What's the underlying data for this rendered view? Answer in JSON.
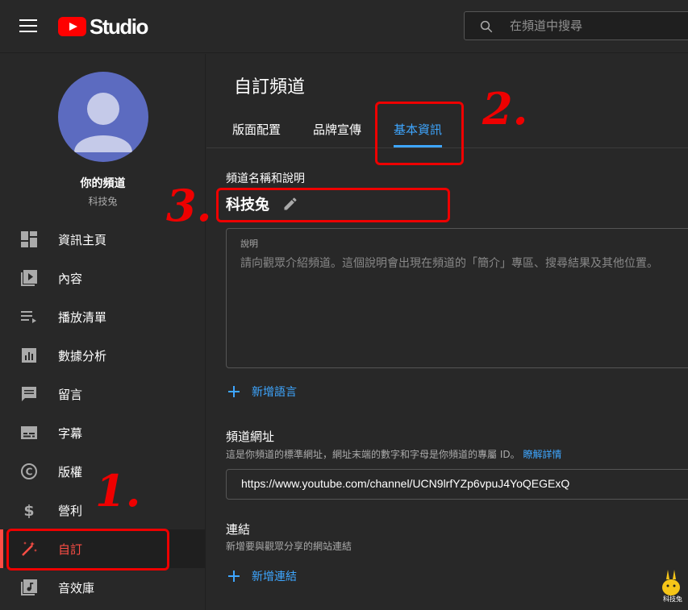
{
  "header": {
    "logo_text": "Studio",
    "search_placeholder": "在頻道中搜尋"
  },
  "sidebar": {
    "channel_title": "你的頻道",
    "channel_name": "科技兔",
    "items": [
      {
        "label": "資訊主頁",
        "icon": "dashboard-icon"
      },
      {
        "label": "內容",
        "icon": "content-icon"
      },
      {
        "label": "播放清單",
        "icon": "playlist-icon"
      },
      {
        "label": "數據分析",
        "icon": "analytics-icon"
      },
      {
        "label": "留言",
        "icon": "comments-icon"
      },
      {
        "label": "字幕",
        "icon": "subtitles-icon"
      },
      {
        "label": "版權",
        "icon": "copyright-icon"
      },
      {
        "label": "營利",
        "icon": "dollar-icon"
      },
      {
        "label": "自訂",
        "icon": "magic-wand-icon",
        "active": true
      },
      {
        "label": "音效庫",
        "icon": "audio-library-icon"
      }
    ]
  },
  "main": {
    "title": "自訂頻道",
    "tabs": [
      {
        "label": "版面配置"
      },
      {
        "label": "品牌宣傳"
      },
      {
        "label": "基本資訊",
        "active": true
      }
    ],
    "name_section": {
      "label": "頻道名稱和說明",
      "channel_name": "科技兔",
      "description_label": "說明",
      "description_placeholder": "請向觀眾介紹頻道。這個說明會出現在頻道的「簡介」專區、搜尋結果及其他位置。"
    },
    "add_language": "新增語言",
    "url_section": {
      "label": "頻道網址",
      "help": "這是你頻道的標準網址，網址末端的數字和字母是你頻道的專屬 ID。",
      "help_link": "瞭解詳情",
      "url": "https://www.youtube.com/channel/UCN9lrfYZp6vpuJ4YoQEGExQ"
    },
    "links_section": {
      "label": "連結",
      "help": "新增要與觀眾分享的網站連結",
      "add_link": "新增連結"
    }
  },
  "annotations": {
    "step1": "1.",
    "step2": "2.",
    "step3": "3."
  },
  "watermark": "科技兔",
  "colors": {
    "background": "#282828",
    "accent_blue": "#3ea6ff",
    "active_red": "#ff4e45",
    "annotation_red": "#e00000",
    "avatar": "#5c6bc0"
  }
}
